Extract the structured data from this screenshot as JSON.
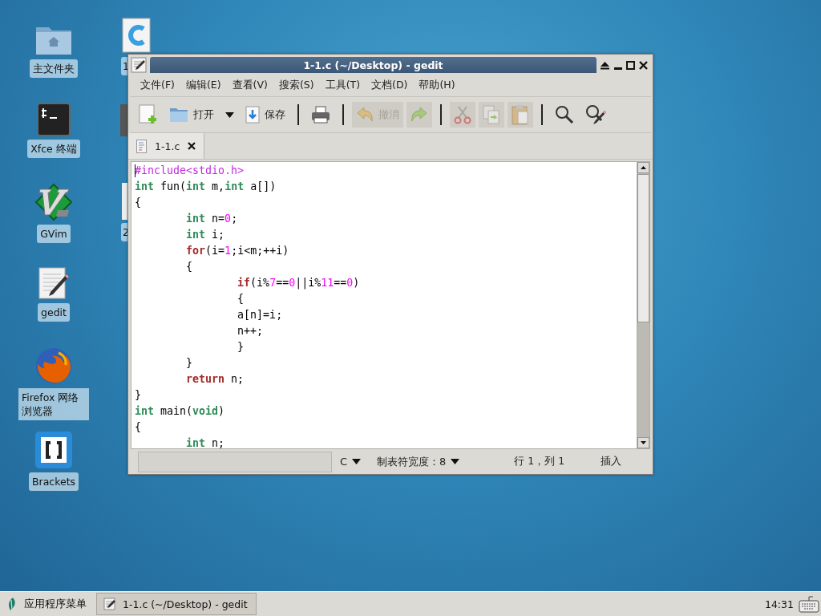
{
  "desktop_icons": [
    {
      "label": "主文件夹"
    },
    {
      "label": "Xfce 终端"
    },
    {
      "label": "GVim"
    },
    {
      "label": "gedit"
    },
    {
      "label": "Firefox 网络浏览器"
    },
    {
      "label": "Brackets"
    }
  ],
  "desktop_icons_behind": [
    {
      "label": "1"
    },
    {
      "label": "2"
    }
  ],
  "window": {
    "title": "1-1.c (~/Desktop) - gedit",
    "menu": [
      "文件(F)",
      "编辑(E)",
      "查看(V)",
      "搜索(S)",
      "工具(T)",
      "文档(D)",
      "帮助(H)"
    ],
    "toolbar": [
      {
        "kind": "button",
        "disabled": false
      },
      {
        "kind": "button",
        "label": "打开",
        "disabled": false
      },
      {
        "kind": "dropdown",
        "disabled": false
      },
      {
        "kind": "button",
        "label": "保存",
        "disabled": false
      },
      {
        "kind": "separator"
      },
      {
        "kind": "button",
        "disabled": false
      },
      {
        "kind": "separator"
      },
      {
        "kind": "button",
        "label": "撤消",
        "disabled": true
      },
      {
        "kind": "button",
        "disabled": true
      },
      {
        "kind": "separator"
      },
      {
        "kind": "button",
        "disabled": true
      },
      {
        "kind": "button",
        "disabled": true
      },
      {
        "kind": "button",
        "disabled": true
      },
      {
        "kind": "separator"
      },
      {
        "kind": "button",
        "disabled": false
      },
      {
        "kind": "button",
        "disabled": false
      }
    ],
    "tabs": [
      {
        "label": "1-1.c",
        "selected": true
      }
    ],
    "code_lines": [
      [
        {
          "kind": "preproc",
          "text": "#include<stdio.h>"
        }
      ],
      [
        {
          "kind": "type",
          "text": "int"
        },
        {
          "kind": "plain",
          "text": " fun("
        },
        {
          "kind": "type",
          "text": "int"
        },
        {
          "kind": "plain",
          "text": " m,"
        },
        {
          "kind": "type",
          "text": "int"
        },
        {
          "kind": "plain",
          "text": " a[])"
        }
      ],
      [
        {
          "kind": "plain",
          "text": "{"
        }
      ],
      [
        {
          "kind": "type",
          "text": "\tint"
        },
        {
          "kind": "plain",
          "text": " n="
        },
        {
          "kind": "number",
          "text": "0"
        },
        {
          "kind": "plain",
          "text": ";"
        }
      ],
      [
        {
          "kind": "type",
          "text": "\tint"
        },
        {
          "kind": "plain",
          "text": " i;"
        }
      ],
      [
        {
          "kind": "keyword",
          "text": "\tfor"
        },
        {
          "kind": "plain",
          "text": "(i="
        },
        {
          "kind": "number",
          "text": "1"
        },
        {
          "kind": "plain",
          "text": ";i<m;++i)"
        }
      ],
      [
        {
          "kind": "plain",
          "text": "\t{"
        }
      ],
      [
        {
          "kind": "keyword",
          "text": "\t\tif"
        },
        {
          "kind": "plain",
          "text": "(i%"
        },
        {
          "kind": "number",
          "text": "7"
        },
        {
          "kind": "plain",
          "text": "=="
        },
        {
          "kind": "number",
          "text": "0"
        },
        {
          "kind": "plain",
          "text": "||i%"
        },
        {
          "kind": "number",
          "text": "11"
        },
        {
          "kind": "plain",
          "text": "=="
        },
        {
          "kind": "number",
          "text": "0"
        },
        {
          "kind": "plain",
          "text": ")"
        }
      ],
      [
        {
          "kind": "plain",
          "text": "\t\t{"
        }
      ],
      [
        {
          "kind": "plain",
          "text": "\t\ta[n]=i;"
        }
      ],
      [
        {
          "kind": "plain",
          "text": "\t\tn++;"
        }
      ],
      [
        {
          "kind": "plain",
          "text": "\t\t}"
        }
      ],
      [
        {
          "kind": "plain",
          "text": "\t}"
        }
      ],
      [
        {
          "kind": "keyword",
          "text": "\treturn"
        },
        {
          "kind": "plain",
          "text": " n;"
        }
      ],
      [
        {
          "kind": "plain",
          "text": "}"
        }
      ],
      [
        {
          "kind": "type",
          "text": "int"
        },
        {
          "kind": "plain",
          "text": " main("
        },
        {
          "kind": "type",
          "text": "void"
        },
        {
          "kind": "plain",
          "text": ")"
        }
      ],
      [
        {
          "kind": "plain",
          "text": "{"
        }
      ],
      [
        {
          "kind": "type",
          "text": "\tint"
        },
        {
          "kind": "plain",
          "text": " n;"
        }
      ]
    ],
    "status_bar": {
      "language": "C",
      "tab_width": "制表符宽度：8",
      "position": "行 1，列 1",
      "mode": "插入"
    }
  },
  "taskbar": {
    "menu_button": "应用程序菜单",
    "tasks": [
      {
        "label": "1-1.c (~/Desktop) - gedit",
        "selected": false
      }
    ],
    "clock": "14:31"
  }
}
